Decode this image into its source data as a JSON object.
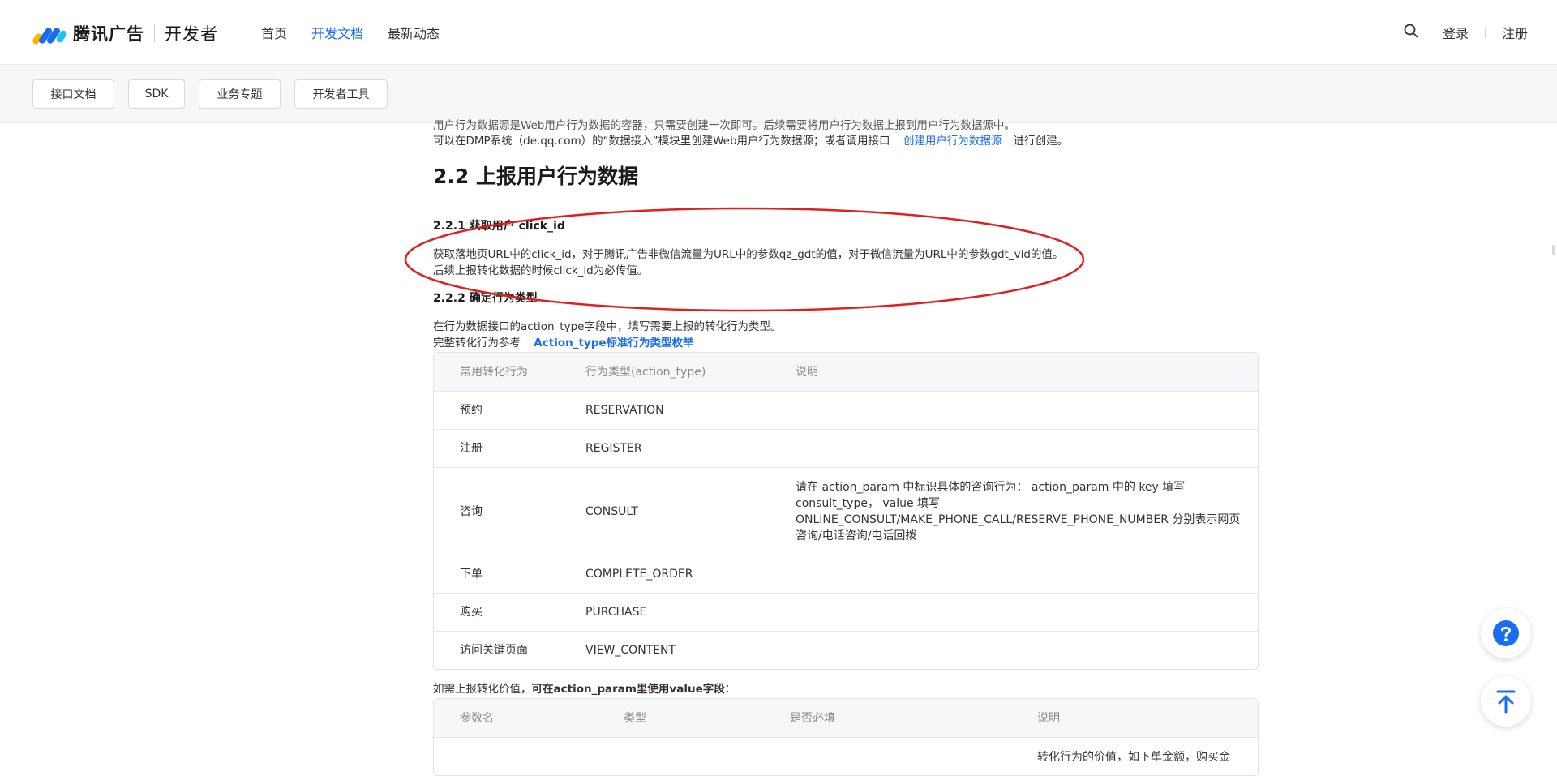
{
  "header": {
    "brand": "腾讯广告",
    "brand_sub": "开发者",
    "nav": [
      "首页",
      "开发文档",
      "最新动态"
    ],
    "login": "登录",
    "register": "注册"
  },
  "categories": [
    "接口文档",
    "SDK",
    "业务专题",
    "开发者工具"
  ],
  "content": {
    "intro_line1": "用户行为数据源是Web用户行为数据的容器，只需要创建一次即可。后续需要将用户行为数据上报到用户行为数据源中。",
    "intro_line2_pre": "可以在DMP系统（de.qq.com）的“数据接入”模块里创建Web用户行为数据源；或者调用接口",
    "intro_line2_link": "创建用户行为数据源",
    "intro_line2_post": "进行创建。",
    "section_title": "2.2 上报用户行为数据",
    "sub1_title": "2.2.1 获取用户 click_id",
    "sub1_p1": "获取落地页URL中的click_id，对于腾讯广告非微信流量为URL中的参数qz_gdt的值，对于微信流量为URL中的参数gdt_vid的值。",
    "sub1_p2": "后续上报转化数据的时候click_id为必传值。",
    "sub2_title": "2.2.2 确定行为类型",
    "sub2_p1": "在行为数据接口的action_type字段中，填写需要上报的转化行为类型。",
    "sub2_p2_pre": "完整转化行为参考",
    "sub2_p2_link": "Action_type标准行为类型枚举",
    "table1": {
      "headers": [
        "常用转化行为",
        "行为类型(action_type)",
        "说明"
      ],
      "rows": [
        {
          "a": "预约",
          "b": "RESERVATION",
          "c": ""
        },
        {
          "a": "注册",
          "b": "REGISTER",
          "c": ""
        },
        {
          "a": "咨询",
          "b": "CONSULT",
          "c1": "请在 action_param 中标识具体的咨询行为： action_param 中的 key 填写",
          "c2": "consult_type， value 填写",
          "c3": "ONLINE_CONSULT/MAKE_PHONE_CALL/RESERVE_PHONE_NUMBER 分别表示网页",
          "c4": "咨询/电话咨询/电话回拨"
        },
        {
          "a": "下单",
          "b": "COMPLETE_ORDER",
          "c": ""
        },
        {
          "a": "购买",
          "b": "PURCHASE",
          "c": ""
        },
        {
          "a": "访问关键页面",
          "b": "VIEW_CONTENT",
          "c": ""
        }
      ]
    },
    "value_p_pre": "如需上报转化价值，",
    "value_p_bold": "可在action_param里使用value字段",
    "value_p_post": "：",
    "table2": {
      "headers": [
        "参数名",
        "类型",
        "是否必填",
        "说明"
      ],
      "row_desc_partial": "转化行为的价值，如下单金额，购买金"
    }
  },
  "colors": {
    "accent": "#1a6cf0",
    "annotation": "#e02020"
  }
}
